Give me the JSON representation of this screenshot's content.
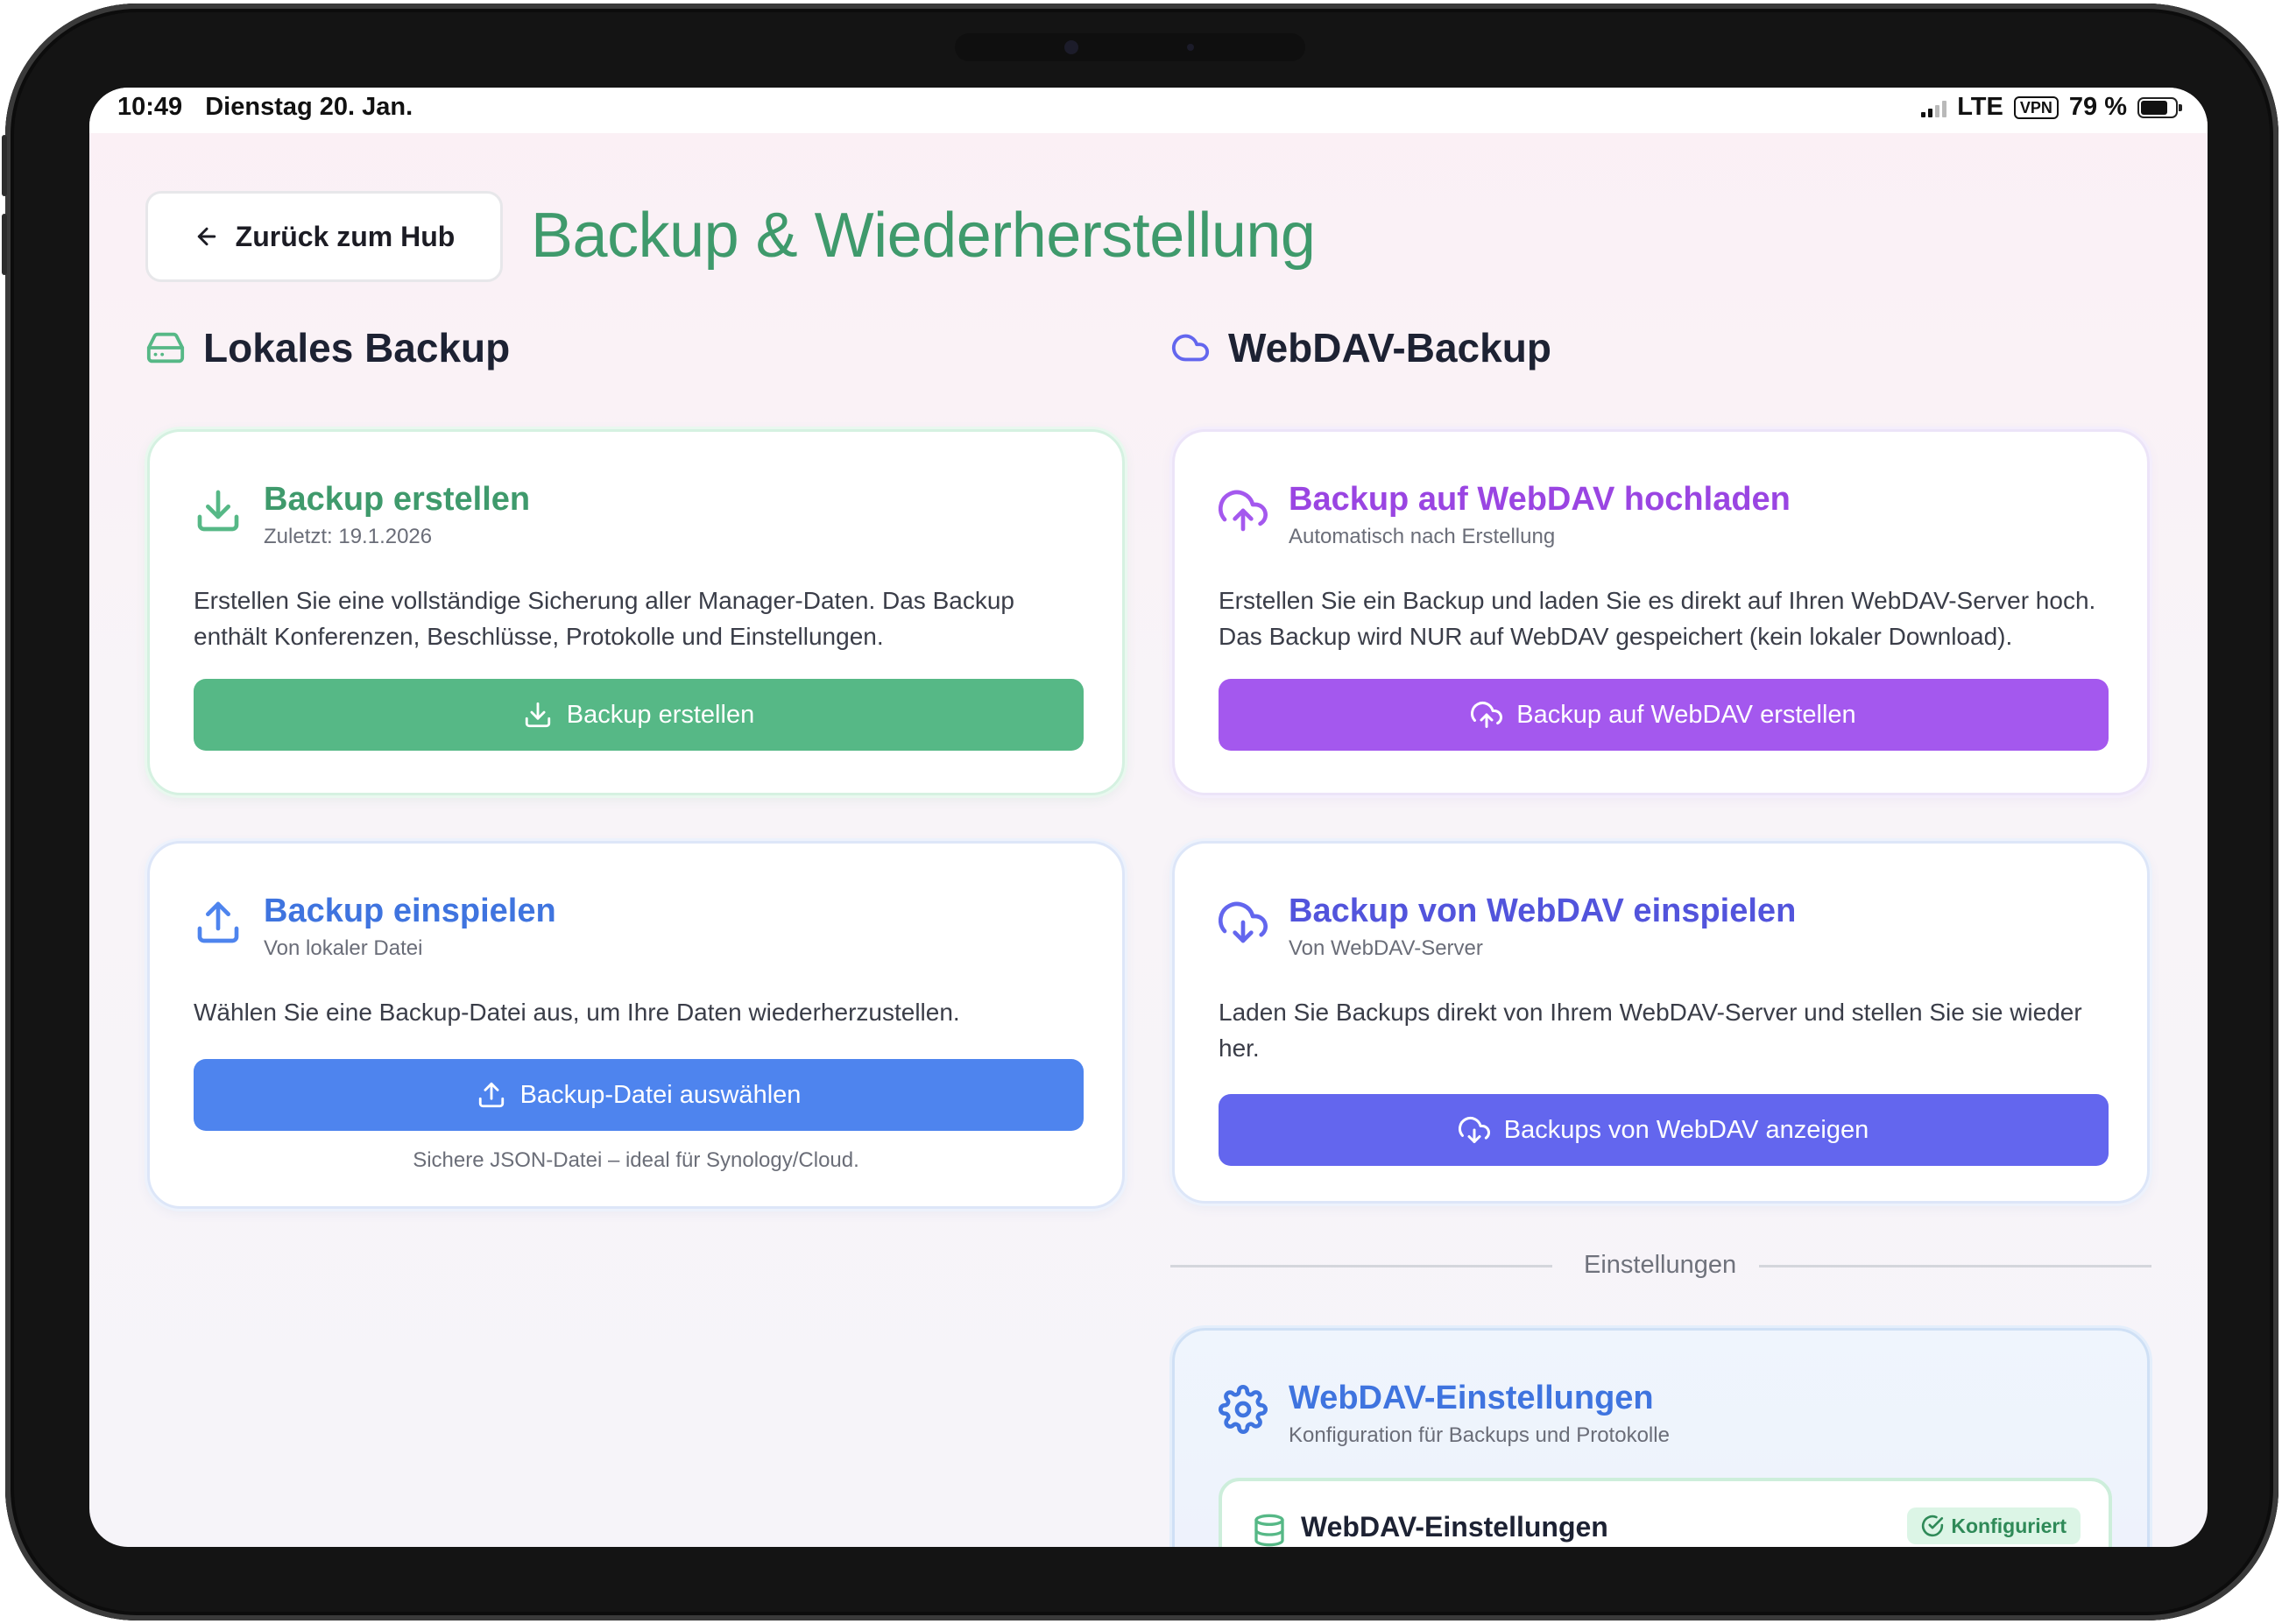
{
  "status_bar": {
    "time": "10:49",
    "date": "Dienstag 20. Jan.",
    "network": "LTE",
    "vpn": "VPN",
    "battery": "79 %",
    "battery_level": 0.79
  },
  "header": {
    "back_label": "Zurück zum Hub",
    "title": "Backup & Wiederherstellung"
  },
  "local_section": {
    "heading": "Lokales Backup",
    "create_card": {
      "title": "Backup erstellen",
      "subtitle": "Zuletzt: 19.1.2026",
      "description": "Erstellen Sie eine vollständige Sicherung aller Manager-Daten. Das Backup enthält Konferenzen, Beschlüsse, Protokolle und Einstellungen.",
      "button": "Backup erstellen"
    },
    "restore_card": {
      "title": "Backup einspielen",
      "subtitle": "Von lokaler Datei",
      "description": "Wählen Sie eine Backup-Datei aus, um Ihre Daten wiederherzustellen.",
      "button": "Backup-Datei auswählen",
      "note": "Sichere JSON-Datei – ideal für Synology/Cloud."
    }
  },
  "webdav_section": {
    "heading": "WebDAV-Backup",
    "upload_card": {
      "title": "Backup auf WebDAV hochladen",
      "subtitle": "Automatisch nach Erstellung",
      "description": "Erstellen Sie ein Backup und laden Sie es direkt auf Ihren WebDAV-Server hoch. Das Backup wird NUR auf WebDAV gespeichert (kein lokaler Download).",
      "button": "Backup auf WebDAV erstellen"
    },
    "restore_card": {
      "title": "Backup von WebDAV einspielen",
      "subtitle": "Von WebDAV-Server",
      "description": "Laden Sie Backups direkt von Ihrem WebDAV-Server und stellen Sie sie wieder her.",
      "button": "Backups von WebDAV anzeigen"
    },
    "divider_label": "Einstellungen",
    "settings_card": {
      "title": "WebDAV-Einstellungen",
      "subtitle": "Konfiguration für Backups und Protokolle",
      "panel_title": "WebDAV-Einstellungen",
      "badge": "Konfiguriert"
    }
  },
  "colors": {
    "green": "#56b886",
    "green_text": "#3f9a6c",
    "blue": "#4e84ee",
    "blue_text": "#3f74df",
    "purple": "#a458ee",
    "purple_text": "#9a45e2",
    "indigo": "#6366ee",
    "indigo_text": "#5254dc"
  },
  "icons": {
    "back": "arrow-left-icon",
    "local_heading": "hard-drive-icon",
    "webdav_heading": "cloud-icon",
    "create": "download-icon",
    "restore": "upload-icon",
    "webdav_upload": "cloud-upload-icon",
    "webdav_restore": "cloud-download-icon",
    "settings": "gear-icon",
    "database": "database-icon",
    "badge": "check-circle-icon"
  }
}
